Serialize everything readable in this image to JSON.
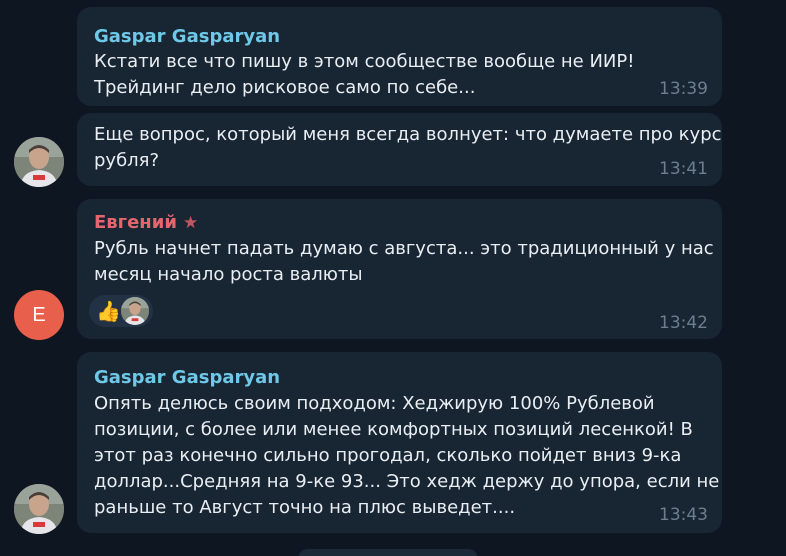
{
  "messages": [
    {
      "sender": "Gaspar Gasparyan",
      "text": "Кстати все что пишу в этом сообществе вообще не ИИР!\nТрейдинг дело рисковое само по себе...",
      "time": "13:39"
    },
    {
      "text": "Еще вопрос, который меня всегда волнует: что думаете про курс\nрубля?",
      "time": "13:41",
      "avatar": "user-photo"
    },
    {
      "sender": "Евгений",
      "badge": "star-icon",
      "text": "Рубль начнет падать думаю с августа... это традиционный у нас\nмесяц начало роста валюты",
      "time": "13:42",
      "avatar_letter": "Е",
      "reaction": {
        "emoji": "👍",
        "reactor": "user-photo"
      }
    },
    {
      "sender": "Gaspar Gasparyan",
      "text": "Опять делюсь своим подходом: Хеджирую 100% Рублевой\nпозиции, с более или менее комфортных позиций лесенкой! В\nэтот раз конечно сильно прогодал, сколько пойдет вниз 9-ка\nдоллар...Средняя на 9-ке 93... Это хедж держу до упора, если не\nраньше то Август точно на плюс выведет....",
      "time": "13:43",
      "avatar": "user-photo"
    }
  ],
  "colors": {
    "background": "#0e1621",
    "bubble": "#182533",
    "sender_gaspar": "#6ec9e8",
    "sender_evgeniy": "#e4676f",
    "avatar_e": "#e8604c",
    "timestamp": "#6d7f8f"
  }
}
